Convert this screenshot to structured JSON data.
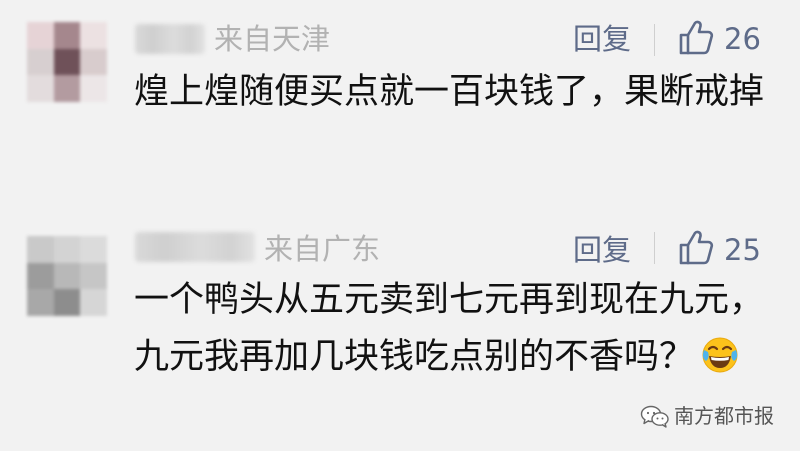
{
  "colors": {
    "background": "#f2f2f2",
    "meta_text": "#b2b2b2",
    "action_text": "#5e6b89",
    "body_text": "#111111"
  },
  "comments": [
    {
      "location": "来自天津",
      "reply_label": "回复",
      "likes": "26",
      "text": "煌上煌随便买点就一百块钱了，果断戒掉",
      "avatar_colors": [
        "#e6d3d6",
        "#a5878d",
        "#ece1e2",
        "#d7cfd0",
        "#6f5159",
        "#d8cccd",
        "#e3dcdd",
        "#b39ba0",
        "#ece6e7"
      ]
    },
    {
      "location": "来自广东",
      "reply_label": "回复",
      "likes": "25",
      "text": "一个鸭头从五元卖到七元再到现在九元，九元我再加几块钱吃点别的不香吗？",
      "emoji": "face-with-tears-of-joy",
      "avatar_colors": [
        "#c9c9c9",
        "#d3d3d3",
        "#dbdbdb",
        "#9c9c9c",
        "#b8b8b8",
        "#c6c6c6",
        "#a8a8a8",
        "#8d8d8d",
        "#d6d6d6"
      ]
    }
  ],
  "watermark": {
    "icon": "wechat-icon",
    "text": "南方都市报"
  }
}
